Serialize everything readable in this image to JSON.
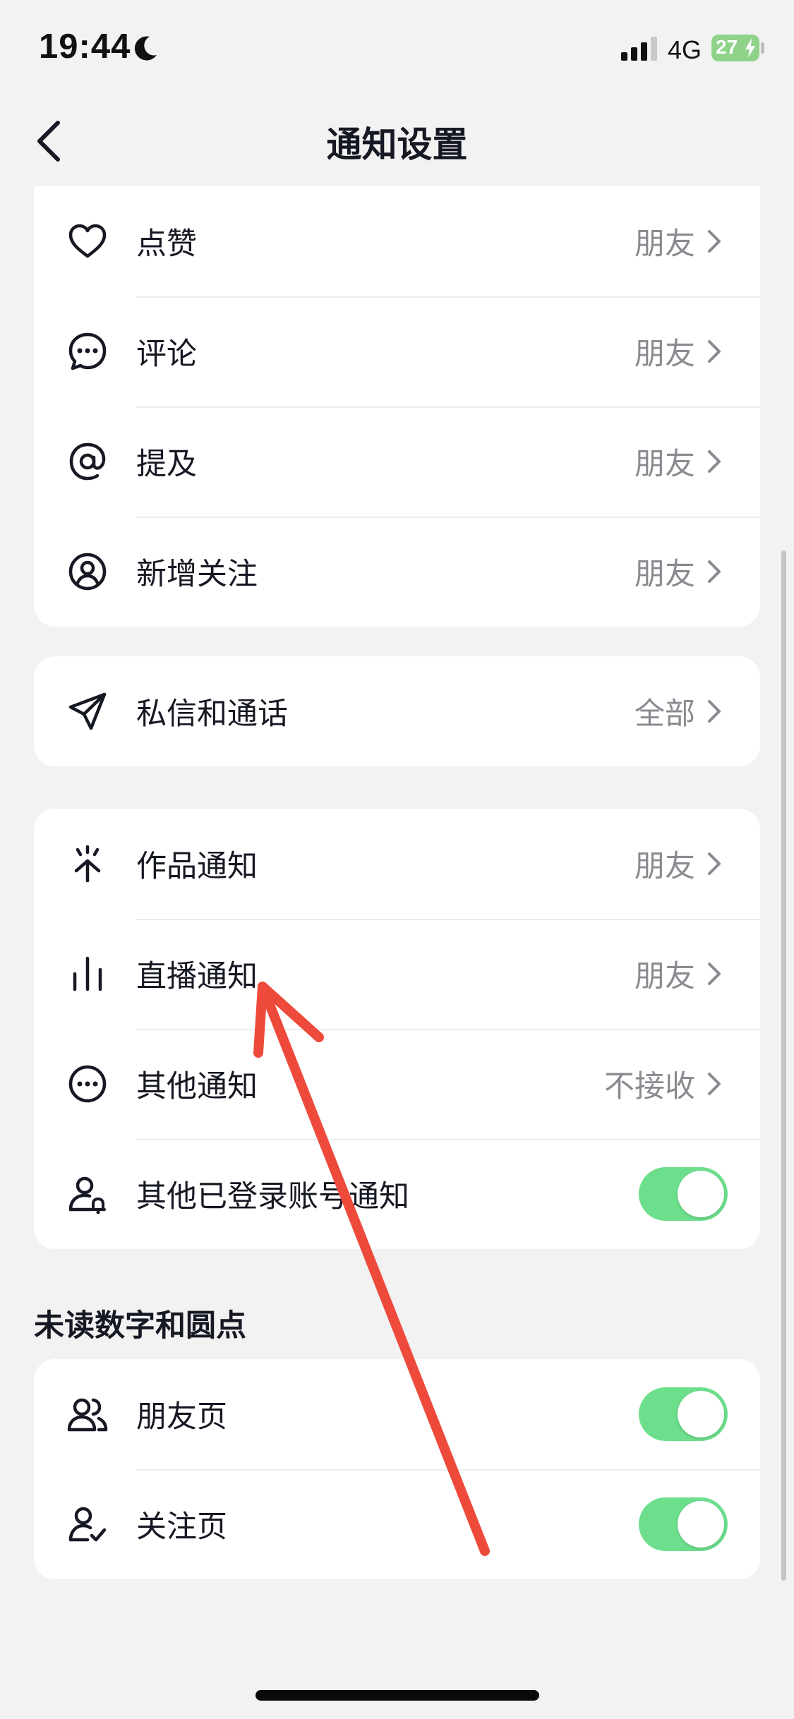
{
  "status_bar": {
    "time": "19:44",
    "network": "4G",
    "battery": "27"
  },
  "nav": {
    "title": "通知设置"
  },
  "interactions": {
    "items": [
      {
        "label": "点赞",
        "value": "朋友",
        "icon": "heart-icon"
      },
      {
        "label": "评论",
        "value": "朋友",
        "icon": "comment-icon"
      },
      {
        "label": "提及",
        "value": "朋友",
        "icon": "at-icon"
      },
      {
        "label": "新增关注",
        "value": "朋友",
        "icon": "user-circle-icon"
      }
    ]
  },
  "messages": {
    "items": [
      {
        "label": "私信和通话",
        "value": "全部",
        "icon": "send-icon"
      }
    ]
  },
  "notices": {
    "items": [
      {
        "label": "作品通知",
        "value": "朋友",
        "icon": "spark-arrow-icon"
      },
      {
        "label": "直播通知",
        "value": "朋友",
        "icon": "live-bars-icon"
      },
      {
        "label": "其他通知",
        "value": "不接收",
        "icon": "more-circle-icon"
      },
      {
        "label": "其他已登录账号通知",
        "toggle": true,
        "icon": "user-bell-icon"
      }
    ]
  },
  "unread": {
    "title": "未读数字和圆点",
    "items": [
      {
        "label": "朋友页",
        "toggle": true,
        "icon": "friends-icon"
      },
      {
        "label": "关注页",
        "toggle": true,
        "icon": "user-check-icon"
      }
    ]
  },
  "colors": {
    "toggle_on": "#6ddf8c",
    "annotation_arrow": "#ee4a3c",
    "value_text": "#8a8b91",
    "background": "#f2f2f2"
  }
}
